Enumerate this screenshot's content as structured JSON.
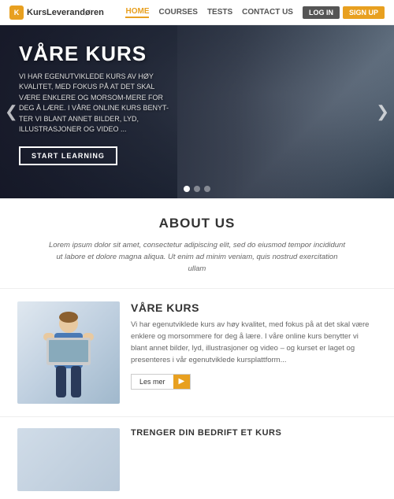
{
  "brand": {
    "logo_icon": "K",
    "name": "KursLeverandøren"
  },
  "nav": {
    "links": [
      {
        "label": "HOME",
        "active": true
      },
      {
        "label": "COURSES",
        "active": false
      },
      {
        "label": "TESTS",
        "active": false
      },
      {
        "label": "CONTACT US",
        "active": false
      }
    ],
    "login": "LOG IN",
    "signup": "SIGN UP"
  },
  "hero": {
    "title": "VÅRE KURS",
    "subtitle": "VI HAR EGENUTVIKLEDE KURS AV HØY KVALITET, MED FOKUS PÅ AT DET SKAL VÆRE ENKLERE OG MORSOM-MERE FOR DEG Å LÆRE. I VÅRE ONLINE KURS BENYT-TER VI BLANT ANNET BILDER, LYD, ILLUSTRASJONER OG VIDEO ...",
    "cta": "STaRT Learning",
    "arrow_left": "❮",
    "arrow_right": "❯",
    "dots": [
      true,
      false,
      false
    ]
  },
  "about": {
    "title": "ABOUT US",
    "text": "Lorem ipsum dolor sit amet, consectetur adipiscing elit, sed do eiusmod tempor incididunt ut labore et dolore magna aliqua. Ut enim ad minim veniam, quis nostrud exercitation ullam"
  },
  "kurs": {
    "title": "VÅRE KURS",
    "text": "Vi har egenutviklede kurs av høy kvalitet, med fokus på at det skal være enklere og morsommere for deg å lære. I våre online kurs benytter vi blant annet bilder, lyd, illustrasjoner og video – og kurset er laget og presenteres i vår egenutviklede kursplattform...",
    "btn_label": "Les mer",
    "btn_icon": "▶"
  },
  "trenger": {
    "title": "TRENGER DIN BEDRIFT ET KURS"
  }
}
